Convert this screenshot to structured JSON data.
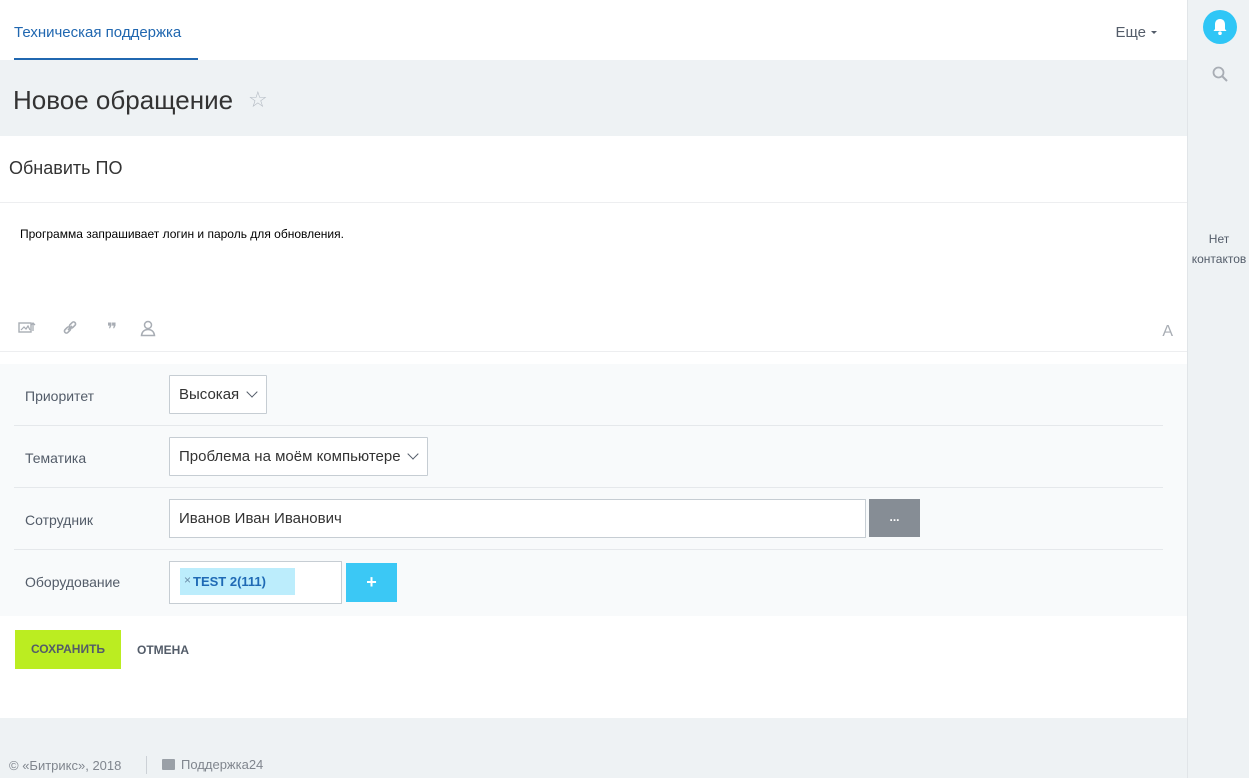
{
  "nav": {
    "tab_label": "Техническая поддержка",
    "more_label": "Еще"
  },
  "page": {
    "title": "Новое обращение"
  },
  "ticket": {
    "subject": "Обнавить ПО",
    "message": "Программа запрашивает логин и пароль для обновления."
  },
  "editor": {
    "font_button": "A"
  },
  "form": {
    "priority": {
      "label": "Приоритет",
      "value": "Высокая"
    },
    "topic": {
      "label": "Тематика",
      "value": "Проблема на моём компьютере"
    },
    "employee": {
      "label": "Сотрудник",
      "value": "Иванов Иван Иванович",
      "picker_label": "..."
    },
    "equipment": {
      "label": "Оборудование",
      "tags": [
        "TEST 2(111)"
      ],
      "add_label": "+"
    }
  },
  "actions": {
    "save_label": "СОХРАНИТЬ",
    "cancel_label": "ОТМЕНА"
  },
  "footer": {
    "copyright": "© «Битрикс», 2018",
    "support_label": "Поддержка24"
  },
  "sidebar": {
    "no_contacts_line1": "Нет",
    "no_contacts_line2": "контактов"
  },
  "colors": {
    "accent_blue": "#2067b0",
    "save_green": "#bbed21",
    "add_blue": "#3bc8f5",
    "tag_bg": "#bcedfc"
  }
}
